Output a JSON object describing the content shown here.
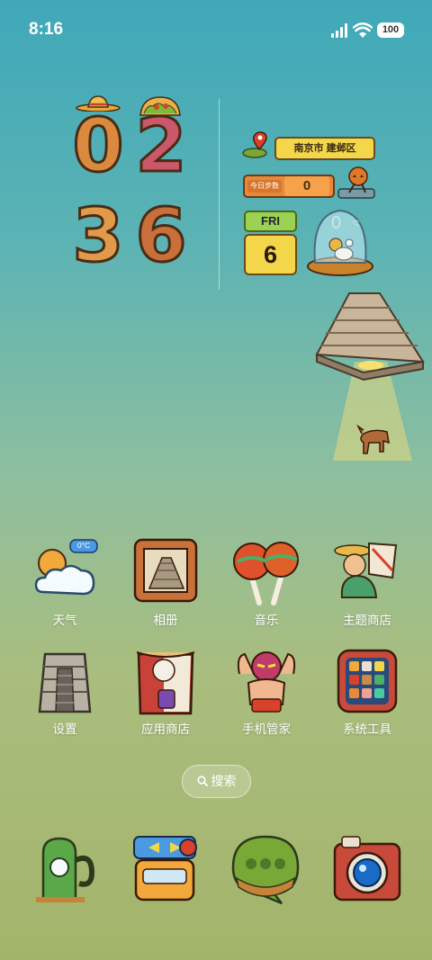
{
  "status_bar": {
    "time": "8:16",
    "battery": "100"
  },
  "clock_widget": {
    "digits": [
      "0",
      "2",
      "3",
      "6"
    ]
  },
  "info_widget": {
    "location": "南京市 建邺区",
    "steps_label": "今日步数",
    "steps_value": "0",
    "weekday": "FRI",
    "day": "6",
    "temperature": "0",
    "temperature_unit": "°C"
  },
  "apps_row1": [
    {
      "label": "天气",
      "icon": "weather-icon",
      "badge": "0°C"
    },
    {
      "label": "相册",
      "icon": "gallery-icon"
    },
    {
      "label": "音乐",
      "icon": "maracas-music-icon"
    },
    {
      "label": "主题商店",
      "icon": "theme-store-icon"
    }
  ],
  "apps_row2": [
    {
      "label": "设置",
      "icon": "settings-temple-icon"
    },
    {
      "label": "应用商店",
      "icon": "app-store-icon"
    },
    {
      "label": "手机管家",
      "icon": "luchador-icon"
    },
    {
      "label": "系统工具",
      "icon": "tools-folder-icon"
    }
  ],
  "search": {
    "label": "搜索"
  },
  "dock": [
    "cactus-phone-icon",
    "messages-icon",
    "chat-bubble-icon",
    "camera-icon"
  ]
}
